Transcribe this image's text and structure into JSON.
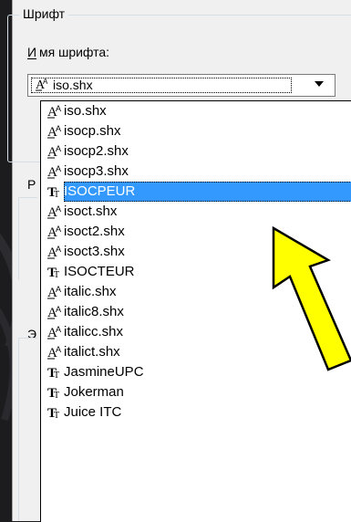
{
  "dialog": {
    "group_title": "Шрифт",
    "font_name_label_mnemonic": "И",
    "font_name_label_rest": "мя шрифта:",
    "combo_value": "iso.shx",
    "bg_letter_r": "Р",
    "bg_letter_e": "Э"
  },
  "font_list": [
    {
      "label": "iso.shx",
      "type": "shx"
    },
    {
      "label": "isocp.shx",
      "type": "shx"
    },
    {
      "label": "isocp2.shx",
      "type": "shx"
    },
    {
      "label": "isocp3.shx",
      "type": "shx"
    },
    {
      "label": "ISOCPEUR",
      "type": "truetype",
      "selected": true
    },
    {
      "label": "isoct.shx",
      "type": "shx"
    },
    {
      "label": "isoct2.shx",
      "type": "shx"
    },
    {
      "label": "isoct3.shx",
      "type": "shx"
    },
    {
      "label": "ISOCTEUR",
      "type": "truetype"
    },
    {
      "label": "italic.shx",
      "type": "shx"
    },
    {
      "label": "italic8.shx",
      "type": "shx"
    },
    {
      "label": "italicc.shx",
      "type": "shx"
    },
    {
      "label": "italict.shx",
      "type": "shx"
    },
    {
      "label": "JasmineUPC",
      "type": "truetype"
    },
    {
      "label": "Jokerman",
      "type": "truetype"
    },
    {
      "label": "Juice ITC",
      "type": "truetype"
    }
  ],
  "icons": {
    "shx": "shx-font-icon",
    "truetype": "truetype-font-icon",
    "dropdown": "chevron-down-icon",
    "annotation": "yellow-arrow"
  },
  "colors": {
    "selection": "#3399ff",
    "annotation_arrow": "#ffff00"
  }
}
